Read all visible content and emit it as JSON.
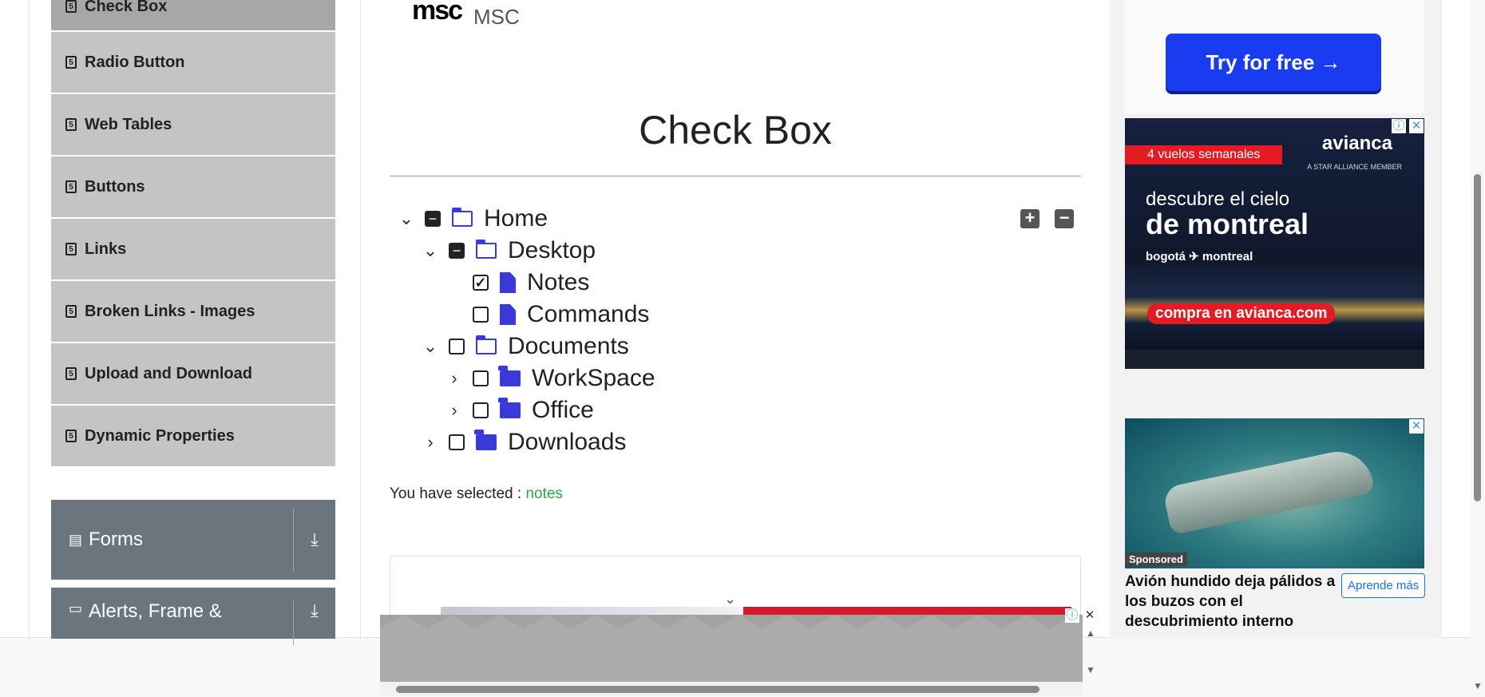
{
  "sidebar": {
    "items": [
      {
        "label": "Check Box",
        "active": true
      },
      {
        "label": "Radio Button"
      },
      {
        "label": "Web Tables"
      },
      {
        "label": "Buttons"
      },
      {
        "label": "Links"
      },
      {
        "label": "Broken Links - Images"
      },
      {
        "label": "Upload and Download"
      },
      {
        "label": "Dynamic Properties"
      }
    ],
    "groups": [
      {
        "label": "Forms"
      },
      {
        "label": "Alerts, Frame &"
      }
    ]
  },
  "header": {
    "logo_glyph": "msc",
    "brand": "MSC"
  },
  "main": {
    "title": "Check Box",
    "tree": [
      {
        "label": "Home",
        "state": "half",
        "icon": "folder-open-icon",
        "expanded": true
      },
      {
        "label": "Desktop",
        "state": "half",
        "icon": "folder-open-icon",
        "expanded": true
      },
      {
        "label": "Notes",
        "state": "checked",
        "icon": "file-icon"
      },
      {
        "label": "Commands",
        "state": "unchecked",
        "icon": "file-icon"
      },
      {
        "label": "Documents",
        "state": "unchecked",
        "icon": "folder-open-icon",
        "expanded": true
      },
      {
        "label": "WorkSpace",
        "state": "unchecked",
        "icon": "folder-icon",
        "expanded": false
      },
      {
        "label": "Office",
        "state": "unchecked",
        "icon": "folder-icon",
        "expanded": false
      },
      {
        "label": "Downloads",
        "state": "unchecked",
        "icon": "folder-icon",
        "expanded": false
      }
    ],
    "expand_all": "+",
    "collapse_all": "−",
    "result_prefix": "You have selected :",
    "result_value": "notes"
  },
  "ads": {
    "try_button": "Try for free →",
    "avianca": {
      "badge": "4 vuelos semanales",
      "logo": "avianca",
      "logo_sub": "A STAR ALLIANCE MEMBER",
      "line1": "descubre el cielo",
      "line2": "de montreal",
      "route": "bogotá ✈ montreal",
      "cta": "compra en avianca.com"
    },
    "sponsored": {
      "label": "Sponsored",
      "text": "Avión hundido deja pálidos a los buzos con el descubrimiento interno",
      "button": "Aprende más"
    },
    "close_glyph": "✕",
    "info_glyph": "ⓘ"
  },
  "colors": {
    "accent_blue": "#3a3adb",
    "selected_green": "#28a745",
    "menu_grey": "#c4c4c4",
    "group_grey": "#6b757e"
  }
}
